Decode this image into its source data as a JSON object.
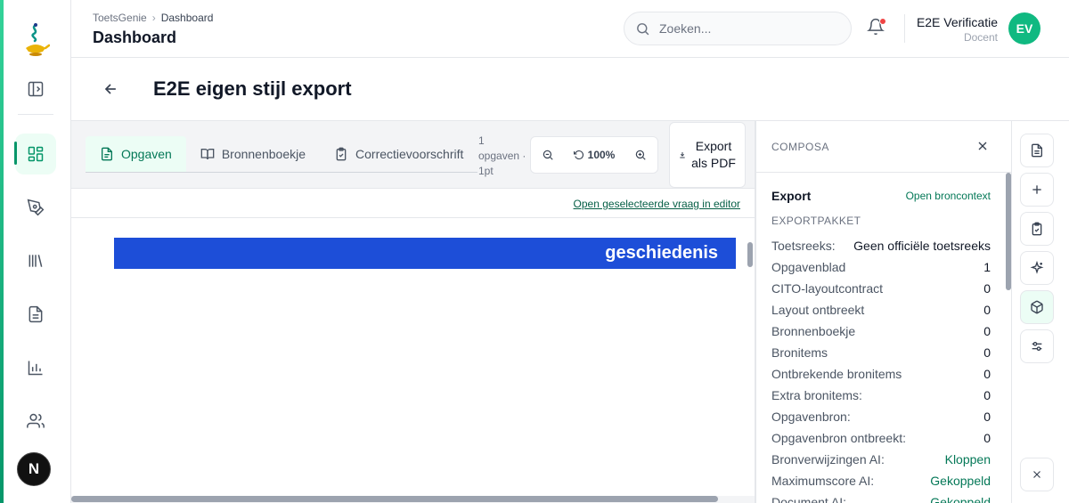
{
  "header": {
    "breadcrumb": [
      "ToetsGenie",
      "Dashboard"
    ],
    "title": "Dashboard",
    "search_placeholder": "Zoeken...",
    "user_name": "E2E Verificatie",
    "user_role": "Docent",
    "user_initials": "EV"
  },
  "sidebar": {
    "items": [
      {
        "icon": "sidebar-toggle-icon"
      },
      {
        "icon": "dashboard-grid-icon",
        "active": true
      },
      {
        "icon": "pen-tool-icon"
      },
      {
        "icon": "library-icon"
      },
      {
        "icon": "document-icon"
      },
      {
        "icon": "bar-chart-icon"
      },
      {
        "icon": "users-icon"
      }
    ],
    "bottom_avatar": "N"
  },
  "page": {
    "title": "E2E eigen stijl export"
  },
  "toolbar": {
    "tabs": [
      {
        "label": "Opgaven",
        "icon": "document-icon",
        "active": true
      },
      {
        "label": "Bronnenboekje",
        "icon": "book-open-icon"
      },
      {
        "label": "Correctievoorschrift",
        "icon": "clipboard-check-icon"
      }
    ],
    "meta": "1 opgaven · 1pt",
    "zoom": "100%",
    "export_label": "Export als PDF"
  },
  "editor": {
    "open_link": "Open geselecteerde vraag in editor",
    "document_banner": "geschiedenis"
  },
  "panel": {
    "title": "COMPOSA",
    "export_title": "Export",
    "open_context": "Open broncontext",
    "section": "EXPORTPAKKET",
    "rows": [
      {
        "k": "Toetsreeks:",
        "v": "Geen officiële toetsreeks"
      },
      {
        "k": "Opgavenblad",
        "v": "1"
      },
      {
        "k": "CITO-layoutcontract",
        "v": "0"
      },
      {
        "k": "Layout ontbreekt",
        "v": "0"
      },
      {
        "k": "Bronnenboekje",
        "v": "0"
      },
      {
        "k": "Bronitems",
        "v": "0"
      },
      {
        "k": "Ontbrekende bronitems",
        "v": "0"
      },
      {
        "k": "Extra bronitems:",
        "v": "0"
      },
      {
        "k": "Opgavenbron:",
        "v": "0"
      },
      {
        "k": "Opgavenbron ontbreekt:",
        "v": "0"
      },
      {
        "k": "Bronverwijzingen AI:",
        "v": "Kloppen",
        "green": true
      },
      {
        "k": "Maximumscore AI:",
        "v": "Gekoppeld",
        "green": true
      },
      {
        "k": "Document AI:",
        "v": "Gekoppeld",
        "green": true
      }
    ]
  },
  "rail": {
    "buttons": [
      "file-text-icon",
      "plus-icon",
      "clipboard-check-icon",
      "sparkles-icon",
      "package-icon",
      "sliders-icon",
      "close-icon"
    ]
  }
}
